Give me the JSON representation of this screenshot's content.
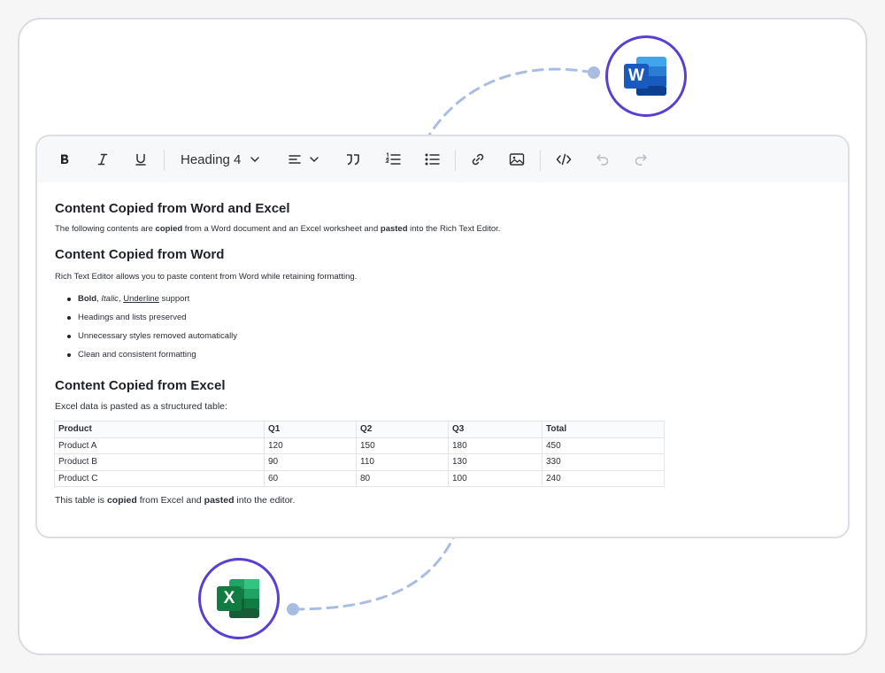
{
  "toolbar": {
    "bold_icon": "bold-icon",
    "italic_icon": "italic-icon",
    "underline_icon": "underline-icon",
    "heading_value": "Heading 4",
    "align_icon": "align-left-icon",
    "blockquote_icon": "quote-icon",
    "ordered_list_icon": "ordered-list-icon",
    "unordered_list_icon": "bullet-list-icon",
    "link_icon": "link-icon",
    "image_icon": "image-icon",
    "code_icon": "code-icon",
    "undo_icon": "undo-icon",
    "redo_icon": "redo-icon"
  },
  "content": {
    "h1": "Content Copied from Word and Excel",
    "intro": {
      "t1": "The following contents are ",
      "b1": "copied",
      "t2": " from a Word document and an Excel worksheet and ",
      "b2": "pasted",
      "t3": " into the Rich Text Editor."
    },
    "h2": "Content Copied from Word",
    "word_para": "Rich Text Editor allows you to paste content from Word while retaining formatting.",
    "list": {
      "bold": "Bold",
      "comma1": ", ",
      "italic": "Italic",
      "comma2": ", ",
      "underline": "Underline",
      "support": " support",
      "item2": "Headings and lists preserved",
      "item3": "Unnecessary styles removed automatically",
      "item4": "Clean and consistent formatting"
    },
    "h3": "Content Copied from Excel",
    "excel_para": "Excel data is pasted as a structured table:",
    "table": {
      "headers": [
        "Product",
        "Q1",
        "Q2",
        "Q3",
        "Total"
      ],
      "rows": [
        [
          "Product A",
          "120",
          "150",
          "180",
          "450"
        ],
        [
          "Product B",
          "90",
          "110",
          "130",
          "330"
        ],
        [
          "Product C",
          "60",
          "80",
          "100",
          "240"
        ]
      ]
    },
    "footer": {
      "t1": "This table is ",
      "b1": "copied",
      "t2": " from Excel and ",
      "b2": "pasted",
      "t3": " into the editor."
    }
  },
  "badges": {
    "word_letter": "W",
    "word_icon": "microsoft-word-icon",
    "excel_letter": "X",
    "excel_icon": "microsoft-excel-icon"
  },
  "colors": {
    "accent_circle": "#5b3fd0",
    "arrow": "#a9bde3",
    "word_blue": "#185abd",
    "excel_green": "#107c41"
  }
}
